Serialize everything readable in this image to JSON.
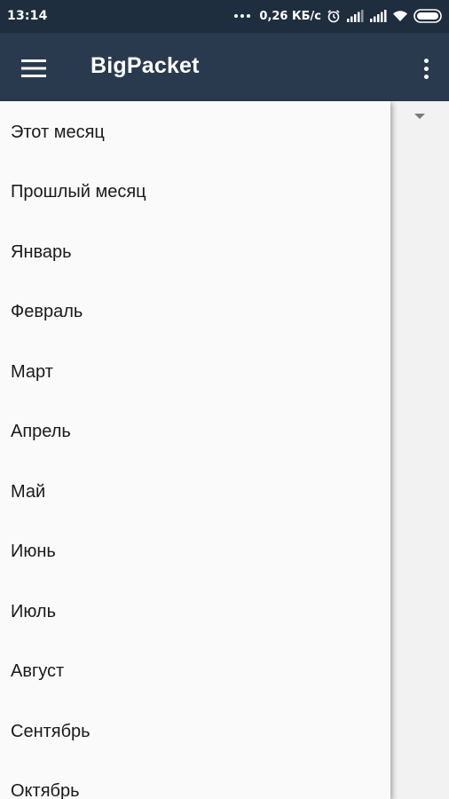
{
  "status_bar": {
    "time": "13:14",
    "network_speed": "0,26 КБ/с",
    "icons": [
      "more-dots-icon",
      "alarm-icon",
      "signal-icon",
      "signal-icon",
      "wifi-icon",
      "battery-icon"
    ]
  },
  "app_bar": {
    "title": "BigPacket",
    "menu_icon": "hamburger-menu-icon",
    "overflow_icon": "more-vert-icon"
  },
  "dropdown": {
    "items": [
      "Этот месяц",
      "Прошлый месяц",
      "Январь",
      "Февраль",
      "Март",
      "Апрель",
      "Май",
      "Июнь",
      "Июль",
      "Август",
      "Сентябрь",
      "Октябрь"
    ]
  },
  "colors": {
    "status_bar_bg": "#1f2e3e",
    "app_bar_bg": "#2a3a4e",
    "dropdown_bg": "#fafafa",
    "text": "#1a1a1a"
  }
}
